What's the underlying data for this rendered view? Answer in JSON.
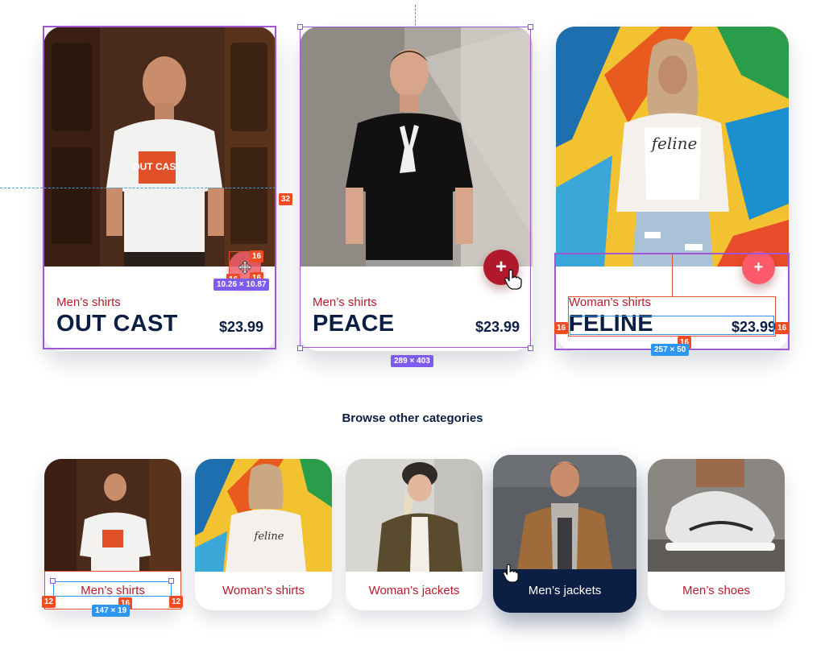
{
  "products": [
    {
      "category": "Men’s shirts",
      "name": "OUT CAST",
      "price": "$23.99",
      "tee_print": "OUT CAST"
    },
    {
      "category": "Men’s shirts",
      "name": "PEACE",
      "price": "$23.99"
    },
    {
      "category": "Woman’s shirts",
      "name": "FELINE",
      "price": "$23.99",
      "tee_print": "feline"
    }
  ],
  "add_button": {
    "symbol": "+"
  },
  "section": {
    "title": "Browse other categories"
  },
  "categories": [
    {
      "label": "Men’s shirts",
      "active": false
    },
    {
      "label": "Woman’s shirts",
      "active": false
    },
    {
      "label": "Woman’s jackets",
      "active": false
    },
    {
      "label": "Men’s jackets",
      "active": true
    },
    {
      "label": "Men’s shoes",
      "active": false
    }
  ],
  "annotations": {
    "spacing_32": "32",
    "spacing_16": "16",
    "spacing_12": "12",
    "card_size": "289 × 403",
    "button_size": "10.26 × 10.87",
    "text_block_size": "257 × 50",
    "tile_label_size": "147 × 19"
  },
  "colors": {
    "navy": "#0b1f44",
    "accent_red": "#b71c2b",
    "button_red": "#ff5a6a",
    "button_dark_red": "#b0192b",
    "selection_purple": "#a156d4",
    "spacing_badge": "#f04b23",
    "dimension_blue": "#2e96f0"
  }
}
